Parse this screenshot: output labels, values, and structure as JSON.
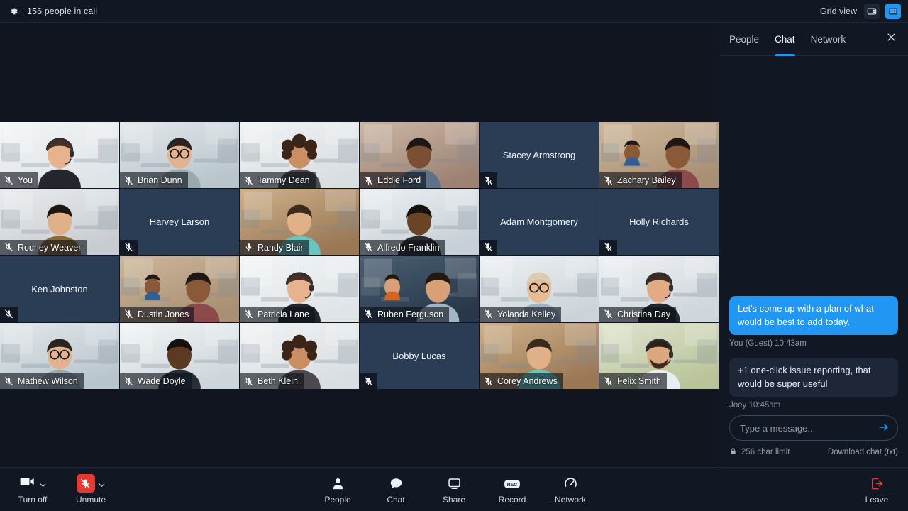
{
  "topbar": {
    "gear_icon": "gear-icon",
    "people_in_call": "156 people in call",
    "view_label": "Grid view",
    "speaker_view_icon": "sidebar-view-icon",
    "grid_view_icon": "grid-view-icon"
  },
  "panel": {
    "tabs": [
      {
        "label": "People",
        "active": false
      },
      {
        "label": "Chat",
        "active": true
      },
      {
        "label": "Network",
        "active": false
      }
    ],
    "close_icon": "close-icon",
    "messages": [
      {
        "text": "Let's come up with a plan of what would be best to add today.",
        "meta": "You (Guest) 10:43am",
        "side": "me"
      },
      {
        "text": "+1 one-click issue reporting, that would be super useful",
        "meta": "Joey 10:45am",
        "side": "them"
      }
    ],
    "composer": {
      "value": "",
      "placeholder": "Type a message...",
      "send_icon": "send-arrow-icon",
      "lock_icon": "lock-icon",
      "char_limit": "256 char limit",
      "download_link": "Download chat (txt)"
    }
  },
  "grid": {
    "tiles": [
      {
        "name": "You",
        "camera": true,
        "muted": true,
        "speaking": false,
        "theme": "office-woman-headset"
      },
      {
        "name": "Brian Dunn",
        "camera": true,
        "muted": true,
        "speaking": false,
        "theme": "cafe-man-glasses"
      },
      {
        "name": "Tammy Dean",
        "camera": true,
        "muted": true,
        "speaking": false,
        "theme": "office-woman-curly"
      },
      {
        "name": "Eddie Ford",
        "camera": true,
        "muted": true,
        "speaking": false,
        "theme": "loft-man-plaid"
      },
      {
        "name": "Stacey Armstrong",
        "camera": false,
        "muted": true,
        "speaking": false,
        "theme": ""
      },
      {
        "name": "Zachary Bailey",
        "camera": true,
        "muted": true,
        "speaking": false,
        "theme": "two-men-desk"
      },
      {
        "name": "Rodney Weaver",
        "camera": true,
        "muted": true,
        "speaking": false,
        "theme": "office-man-tan"
      },
      {
        "name": "Harvey Larson",
        "camera": false,
        "muted": true,
        "speaking": false,
        "theme": ""
      },
      {
        "name": "Randy Blair",
        "camera": true,
        "muted": false,
        "speaking": true,
        "theme": "studio-man-teal"
      },
      {
        "name": "Alfredo Franklin",
        "camera": true,
        "muted": true,
        "speaking": false,
        "theme": "office-man-dark"
      },
      {
        "name": "Adam Montgomery",
        "camera": false,
        "muted": true,
        "speaking": false,
        "theme": ""
      },
      {
        "name": "Holly Richards",
        "camera": false,
        "muted": true,
        "speaking": false,
        "theme": ""
      },
      {
        "name": "Ken Johnston",
        "camera": false,
        "muted": true,
        "speaking": false,
        "theme": ""
      },
      {
        "name": "Dustin Jones",
        "camera": true,
        "muted": true,
        "speaking": false,
        "theme": "two-men-desk"
      },
      {
        "name": "Patricia Lane",
        "camera": true,
        "muted": true,
        "speaking": false,
        "theme": "office-woman-headset"
      },
      {
        "name": "Ruben Ferguson",
        "camera": true,
        "muted": true,
        "speaking": false,
        "theme": "two-men-orange"
      },
      {
        "name": "Yolanda Kelley",
        "camera": true,
        "muted": true,
        "speaking": false,
        "theme": "blonde-woman-glasses"
      },
      {
        "name": "Christina Day",
        "camera": true,
        "muted": true,
        "speaking": false,
        "theme": "office-woman-headset2"
      },
      {
        "name": "Mathew Wilson",
        "camera": true,
        "muted": true,
        "speaking": false,
        "theme": "cafe-man-glasses"
      },
      {
        "name": "Wade Doyle",
        "camera": true,
        "muted": true,
        "speaking": false,
        "theme": "bright-man-smile"
      },
      {
        "name": "Beth Klein",
        "camera": true,
        "muted": true,
        "speaking": false,
        "theme": "office-woman-curly"
      },
      {
        "name": "Bobby Lucas",
        "camera": false,
        "muted": true,
        "speaking": false,
        "theme": ""
      },
      {
        "name": "Corey Andrews",
        "camera": true,
        "muted": true,
        "speaking": false,
        "theme": "studio-man-teal"
      },
      {
        "name": "Felix Smith",
        "camera": true,
        "muted": true,
        "speaking": false,
        "theme": "man-headset-beard"
      }
    ]
  },
  "bottombar": {
    "camera": {
      "label": "Turn off",
      "icon": "camera-icon",
      "chevron": "chevron-down-icon"
    },
    "mic": {
      "label": "Unmute",
      "icon": "mic-muted-icon",
      "chevron": "chevron-down-icon"
    },
    "center": [
      {
        "label": "People",
        "icon": "person-icon"
      },
      {
        "label": "Chat",
        "icon": "speech-bubble-icon"
      },
      {
        "label": "Share",
        "icon": "monitor-icon"
      },
      {
        "label": "Record",
        "icon": "rec-icon"
      },
      {
        "label": "Network",
        "icon": "gauge-icon"
      }
    ],
    "leave": {
      "label": "Leave",
      "icon": "leave-icon"
    }
  },
  "colors": {
    "accent": "#2196f3",
    "speaking": "#e8b83a",
    "danger": "#e53935",
    "camera_off_bg": "#2b3d55",
    "chrome": "#121823"
  }
}
